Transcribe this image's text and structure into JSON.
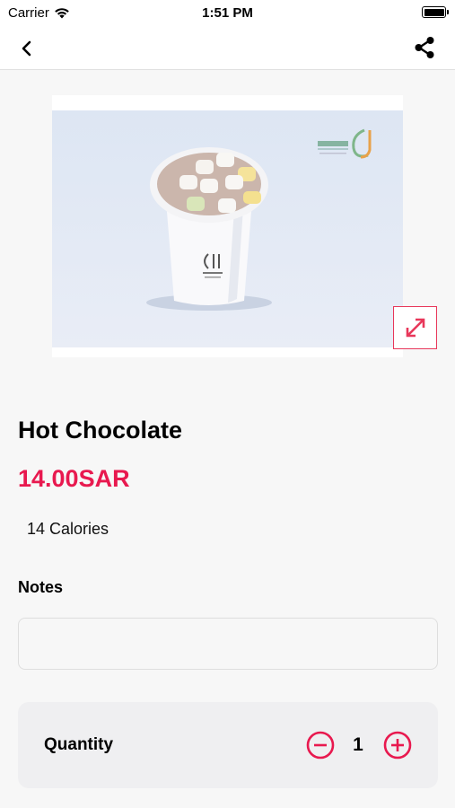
{
  "status_bar": {
    "carrier": "Carrier",
    "time": "1:51 PM"
  },
  "nav": {
    "back_icon": "chevron-left-icon",
    "share_icon": "share-icon"
  },
  "product": {
    "image_alt": "Hot chocolate cup with marshmallows",
    "expand_icon": "expand-icon",
    "title": "Hot Chocolate",
    "price": "14.00SAR",
    "calories": "14 Calories"
  },
  "notes": {
    "label": "Notes",
    "value": "",
    "placeholder": ""
  },
  "quantity": {
    "label": "Quantity",
    "value": "1",
    "minus_icon": "minus-circle-icon",
    "plus_icon": "plus-circle-icon"
  },
  "colors": {
    "accent": "#e8194f",
    "background": "#f7f7f7",
    "card": "#efeff1"
  }
}
